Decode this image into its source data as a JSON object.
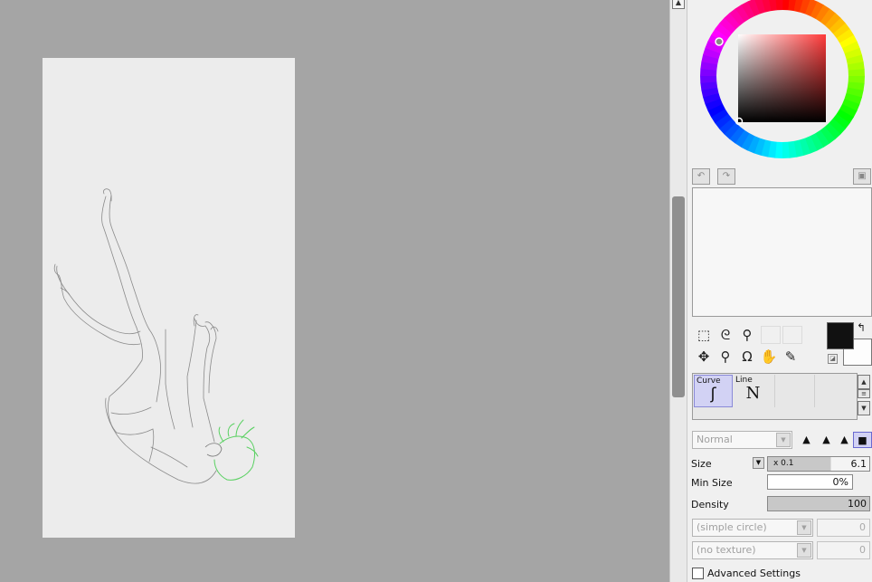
{
  "history": {
    "undo_icon": "undo-icon",
    "redo_icon": "redo-icon",
    "option_icon": "window-icon"
  },
  "tools": {
    "row1": [
      "rect-select-icon",
      "lasso-icon",
      "magic-wand-icon",
      "empty-slot",
      "empty-slot"
    ],
    "row2": [
      "move-icon",
      "zoom-icon",
      "rotate-icon",
      "hand-icon",
      "eyedropper-icon"
    ]
  },
  "colors": {
    "foreground": "#111111",
    "background": "#fdfdfd"
  },
  "brushes": [
    {
      "label": "Curve",
      "icon": "curve-icon",
      "selected": true
    },
    {
      "label": "Line",
      "icon": "line-icon",
      "selected": false
    }
  ],
  "settings": {
    "blend_mode": "Normal",
    "size_label": "Size",
    "size_multiplier": "x 0.1",
    "size_value": "6.1",
    "min_size_label": "Min Size",
    "min_size_value": "0%",
    "density_label": "Density",
    "density_value": "100",
    "shape_value": "(simple circle)",
    "shape_amount": "0",
    "texture_value": "(no texture)",
    "texture_amount": "0",
    "advanced_label": "Advanced Settings",
    "advanced_checked": false
  }
}
